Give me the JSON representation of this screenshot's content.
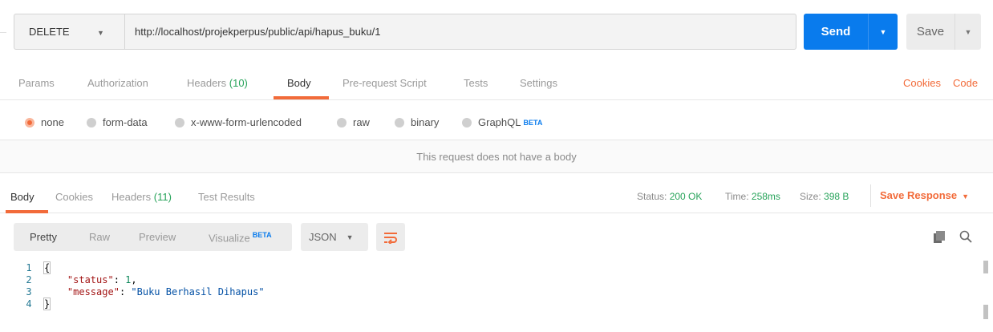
{
  "request": {
    "method": "DELETE",
    "url": "http://localhost/projekperpus/public/api/hapus_buku/1",
    "send_label": "Send",
    "save_label": "Save"
  },
  "request_tabs": {
    "params": "Params",
    "authorization": "Authorization",
    "headers": "Headers",
    "headers_count": "(10)",
    "body": "Body",
    "prerequest": "Pre-request Script",
    "tests": "Tests",
    "settings": "Settings",
    "cookies": "Cookies",
    "code": "Code"
  },
  "body_types": {
    "none": "none",
    "form_data": "form-data",
    "urlencoded": "x-www-form-urlencoded",
    "raw": "raw",
    "binary": "binary",
    "graphql": "GraphQL",
    "beta": "BETA"
  },
  "no_body_message": "This request does not have a body",
  "response_tabs": {
    "body": "Body",
    "cookies": "Cookies",
    "headers": "Headers",
    "headers_count": "(11)",
    "test_results": "Test Results"
  },
  "response_status": {
    "status_label": "Status:",
    "status_value": "200 OK",
    "time_label": "Time:",
    "time_value": "258ms",
    "size_label": "Size:",
    "size_value": "398 B",
    "save_response": "Save Response"
  },
  "response_view": {
    "pretty": "Pretty",
    "raw": "Raw",
    "preview": "Preview",
    "visualize": "Visualize",
    "beta": "BETA",
    "format": "JSON"
  },
  "code": {
    "line_numbers": [
      "1",
      "2",
      "3",
      "4"
    ],
    "open": "{",
    "close": "}",
    "status_key": "\"status\"",
    "status_value": "1",
    "message_key": "\"message\"",
    "message_value": "\"Buku Berhasil Dihapus\""
  },
  "colors": {
    "accent": "#f26b3a",
    "send": "#097bed",
    "success": "#27a35a"
  }
}
